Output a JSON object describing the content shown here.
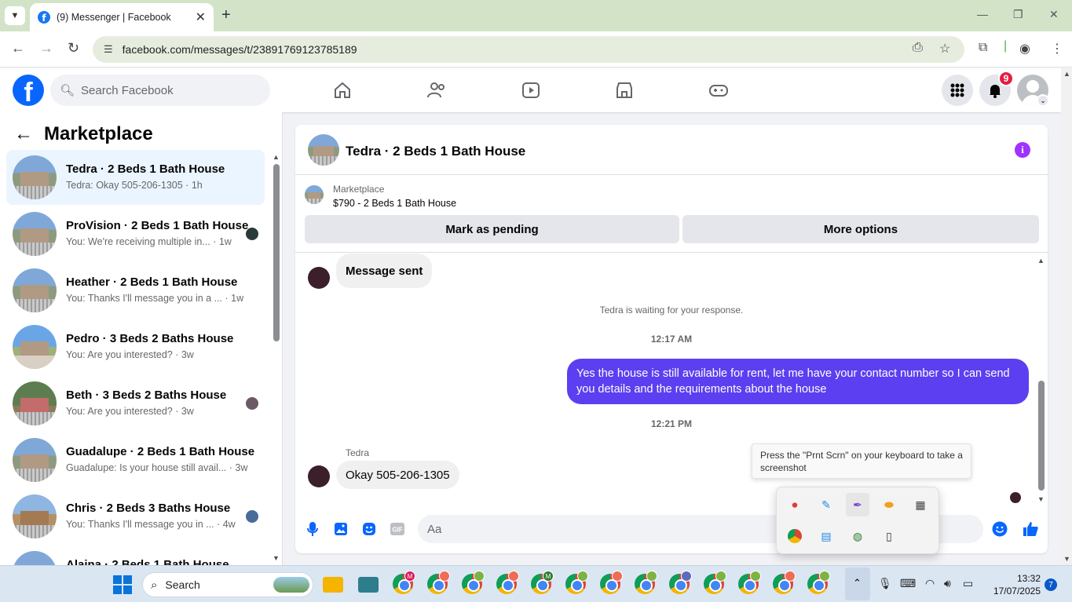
{
  "browser": {
    "tab_title": "(9) Messenger | Facebook",
    "url": "facebook.com/messages/t/23891769123785189"
  },
  "fb": {
    "search_placeholder": "Search Facebook",
    "notification_count": "9",
    "brand_color": "#0866ff"
  },
  "sidebar": {
    "title": "Marketplace",
    "conversations": [
      {
        "name": "Tedra · 2 Beds 1 Bath House",
        "snippet": "Tedra: Okay 505-206-1305 · 1h",
        "active": true
      },
      {
        "name": "ProVision · 2 Beds 1 Bath House",
        "snippet": "You: We're receiving multiple in... · 1w"
      },
      {
        "name": "Heather · 2 Beds 1 Bath House",
        "snippet": "You: Thanks I'll message you in a ... · 1w"
      },
      {
        "name": "Pedro · 3 Beds 2 Baths House",
        "snippet": "You: Are you interested? · 3w"
      },
      {
        "name": "Beth · 3 Beds 2 Baths House",
        "snippet": "You: Are you interested? · 3w"
      },
      {
        "name": "Guadalupe · 2 Beds 1 Bath House",
        "snippet": "Guadalupe: Is your house still avail... · 3w"
      },
      {
        "name": "Chris · 2 Beds 3 Baths House",
        "snippet": "You: Thanks I'll message you in ... · 4w"
      },
      {
        "name": "Alaina · 2 Beds 1 Bath House",
        "snippet": ""
      }
    ]
  },
  "chat": {
    "title": "Tedra · 2 Beds 1 Bath House",
    "listing_category": "Marketplace",
    "listing_price_title": "$790 - 2 Beds 1 Bath House",
    "mark_pending": "Mark as pending",
    "more_options": "More options",
    "msg_sent": "Message sent",
    "waiting": "Tedra is waiting for your response.",
    "ts1": "12:17 AM",
    "out_msg": "Yes the house is still available for rent, let me have your contact number so I can send you details and the requirements about the house",
    "ts2": "12:21 PM",
    "sender": "Tedra",
    "in_msg": "Okay 505-206-1305",
    "composer_placeholder": "Aa",
    "accent_color": "#5b3ff0"
  },
  "tooltip": "Press the \"Prnt Scrn\" on your keyboard to take a screenshot",
  "taskbar": {
    "search": "Search",
    "time": "13:32",
    "date": "17/07/2025",
    "notifications": "7"
  }
}
